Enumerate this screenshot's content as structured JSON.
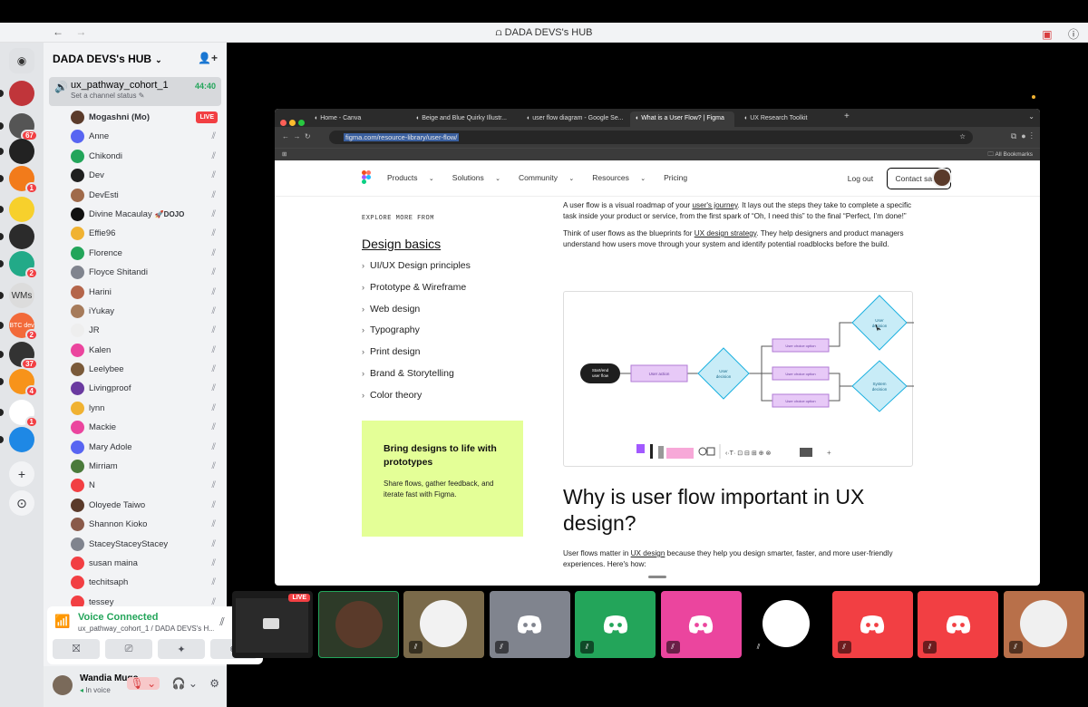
{
  "window": {
    "title": "DADA DEVS's HUB",
    "back": "←",
    "forward": "→"
  },
  "server": {
    "name": "DADA DEVS's HUB",
    "rail": [
      {
        "icon": "discord-home-icon",
        "color": "#dfe1e4",
        "badge": ""
      },
      {
        "icon": "server-avatar-icon",
        "color": "#c0353a",
        "badge": ""
      },
      {
        "icon": "server-avatar-icon",
        "color": "#555555",
        "badge": "67"
      },
      {
        "icon": "server-avatar-icon",
        "color": "#222222",
        "badge": ""
      },
      {
        "icon": "server-avatar-icon",
        "color": "#f27b1b",
        "badge": "1"
      },
      {
        "icon": "server-avatar-icon",
        "color": "#f7d02c",
        "badge": ""
      },
      {
        "icon": "server-avatar-icon",
        "color": "#2b2b2b",
        "badge": ""
      },
      {
        "icon": "server-avatar-icon",
        "color": "#22aa88",
        "badge": "2"
      },
      {
        "icon": "server-avatar-icon",
        "color": "#dcdcdc",
        "badge": ""
      },
      {
        "icon": "server-avatar-icon",
        "color": "#f26a3a",
        "badge": "2"
      },
      {
        "icon": "server-avatar-icon",
        "color": "#333333",
        "badge": "37"
      },
      {
        "icon": "server-avatar-icon",
        "color": "#f7931a",
        "badge": "4"
      },
      {
        "icon": "server-avatar-icon",
        "color": "#ffffff",
        "badge": "1"
      },
      {
        "icon": "server-avatar-icon",
        "color": "#1e88e5",
        "badge": ""
      }
    ],
    "rail_labels": {
      "wms": "WMs",
      "btc": "BTC dev",
      "add_server": "+",
      "discover": "⊙"
    }
  },
  "voice_channel": {
    "name": "ux_pathway_cohort_1",
    "status": "Set a channel status",
    "timer": "44:40"
  },
  "members": [
    {
      "name": "Mogashni (Mo)",
      "live": true,
      "bold": true,
      "avatar_color": "#5b3b2b"
    },
    {
      "name": "Anne",
      "avatar_color": "#5865f2"
    },
    {
      "name": "Chikondi",
      "avatar_color": "#23a55a"
    },
    {
      "name": "Dev",
      "avatar_color": "#1f1f1f"
    },
    {
      "name": "DevEsti",
      "avatar_color": "#a06a4a"
    },
    {
      "name": "Divine Macaulay",
      "tag": "🚀DOJO",
      "avatar_color": "#111111"
    },
    {
      "name": "Effie96",
      "avatar_color": "#f0b232"
    },
    {
      "name": "Florence",
      "avatar_color": "#23a55a"
    },
    {
      "name": "Floyce Shitandi",
      "avatar_color": "#80848e"
    },
    {
      "name": "Harini",
      "avatar_color": "#b4654a"
    },
    {
      "name": "iYukay",
      "avatar_color": "#a67b5b"
    },
    {
      "name": "JR",
      "avatar_color": "#eeeeee"
    },
    {
      "name": "Kalen",
      "avatar_color": "#eb459e"
    },
    {
      "name": "Leelybee",
      "avatar_color": "#7a5a3a"
    },
    {
      "name": "Livingproof",
      "avatar_color": "#6a3aa0"
    },
    {
      "name": "lynn",
      "avatar_color": "#f0b232"
    },
    {
      "name": "Mackie",
      "avatar_color": "#eb459e"
    },
    {
      "name": "Mary Adole",
      "avatar_color": "#5865f2"
    },
    {
      "name": "Mirriam",
      "avatar_color": "#4a7a3a"
    },
    {
      "name": "N",
      "avatar_color": "#f23f43"
    },
    {
      "name": "Oloyede Taiwo",
      "avatar_color": "#5a3a2a"
    },
    {
      "name": "Shannon Kioko",
      "avatar_color": "#8a5a4a"
    },
    {
      "name": "StaceyStaceyStacey",
      "avatar_color": "#80848e"
    },
    {
      "name": "susan maina",
      "avatar_color": "#f23f43"
    },
    {
      "name": "techitsaph",
      "avatar_color": "#f23f43"
    },
    {
      "name": "tessey",
      "avatar_color": "#f23f43"
    }
  ],
  "live_label": "LIVE",
  "voice_panel": {
    "title": "Voice Connected",
    "subtitle": "ux_pathway_cohort_1 / DADA DEVS's H..."
  },
  "user": {
    "name": "Wandia Mugo",
    "status": "In voice"
  },
  "browser": {
    "tabs": [
      {
        "label": "Home - Canva",
        "active": false
      },
      {
        "label": "Beige and Blue Quirky Illustr...",
        "active": false
      },
      {
        "label": "user flow diagram - Google Se...",
        "active": false
      },
      {
        "label": "What is a User Flow? | Figma",
        "active": true
      },
      {
        "label": "UX Research Toolkit",
        "active": false
      }
    ],
    "url": "figma.com/resource-library/user-flow/",
    "bookmarks_label": "All Bookmarks"
  },
  "figma": {
    "nav": [
      "Products",
      "Solutions",
      "Community",
      "Resources",
      "Pricing"
    ],
    "logout": "Log out",
    "contact": "Contact sales",
    "explore_label": "EXPLORE MORE FROM",
    "section_title": "Design basics",
    "topics": [
      "UI/UX Design principles",
      "Prototype & Wireframe",
      "Web design",
      "Typography",
      "Print design",
      "Brand & Storytelling",
      "Color theory"
    ],
    "promo_title": "Bring designs to life with prototypes",
    "promo_desc": "Share flows, gather feedback, and iterate fast with Figma.",
    "para1_a": "A user flow is a visual roadmap of your ",
    "para1_link": "user's journey",
    "para1_b": ". It lays out the steps they take to complete a specific task inside your product or service, from the first spark of “Oh, I need this” to the final “Perfect, I’m done!”",
    "para2_a": "Think of user flows as the blueprints for ",
    "para2_link": "UX design strategy",
    "para2_b": ". They help designers and product managers understand how users move through your system and identify potential roadblocks before the build.",
    "heading": "Why is user flow important in UX design?",
    "bottom_a": "User flows matter in ",
    "bottom_link": "UX design",
    "bottom_b": " because they help you design smarter, faster, and more user-friendly experiences. Here's how:",
    "diagram": {
      "start": "Start/end user flow",
      "action": "User action",
      "decision": "User decision",
      "options": [
        "User choice option",
        "User choice option",
        "User choice option"
      ],
      "top_decision": "User decision",
      "system_decision": "System decision"
    }
  },
  "participants": [
    {
      "kind": "screen",
      "live": true,
      "color": "#1b1b1b"
    },
    {
      "kind": "photo",
      "color": "#2d3a28",
      "face": "#5a3a2a",
      "mute": false,
      "border": "#23a55a"
    },
    {
      "kind": "photo",
      "color": "#7a6a4a",
      "face": "#f2f2f2",
      "mute": true
    },
    {
      "kind": "discord",
      "color": "#80848e",
      "mute": true
    },
    {
      "kind": "discord",
      "color": "#23a55a",
      "mute": true
    },
    {
      "kind": "discord",
      "color": "#eb459e",
      "mute": true
    },
    {
      "kind": "photo",
      "color": "#000000",
      "face": "#ffffff",
      "mute": true
    },
    {
      "kind": "discord",
      "color": "#f23f43",
      "mute": true
    },
    {
      "kind": "discord",
      "color": "#f23f43",
      "mute": true
    },
    {
      "kind": "photo",
      "color": "#b8704a",
      "face": "#f0f0f0",
      "mute": true
    }
  ]
}
